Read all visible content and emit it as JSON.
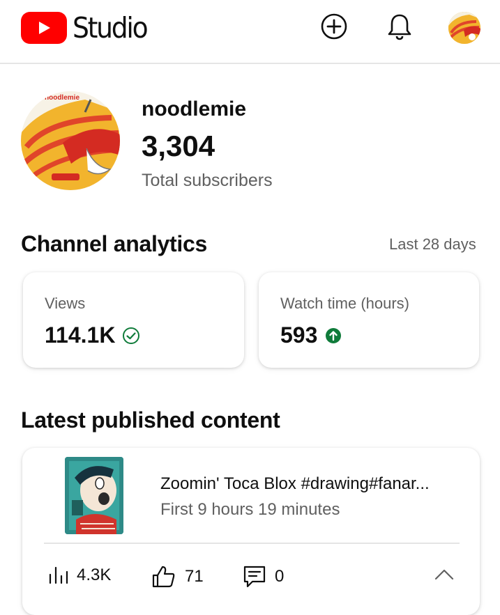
{
  "header": {
    "app_name": "Studio",
    "icons": [
      "youtube-logo-icon",
      "create-plus-icon",
      "bell-icon",
      "account-avatar"
    ]
  },
  "channel": {
    "name": "noodlemie",
    "subscriber_count": "3,304",
    "subscriber_label": "Total subscribers",
    "avatar_text": "noodlemie"
  },
  "analytics": {
    "title": "Channel analytics",
    "range": "Last 28 days",
    "views": {
      "label": "Views",
      "value": "114.1K",
      "status_icon": "check-circle-icon"
    },
    "watch_time": {
      "label": "Watch time (hours)",
      "value": "593",
      "status_icon": "arrow-up-circle-icon"
    }
  },
  "latest": {
    "title": "Latest published content",
    "video": {
      "title": "Zoomin' Toca Blox #drawing#fanar...",
      "subtitle": "First 9 hours 19 minutes",
      "stats": {
        "views": "4.3K",
        "likes": "71",
        "comments": "0"
      }
    }
  },
  "colors": {
    "brand_red": "#ff0000",
    "accent_green": "#0f7b3a",
    "text_secondary": "#606060"
  }
}
